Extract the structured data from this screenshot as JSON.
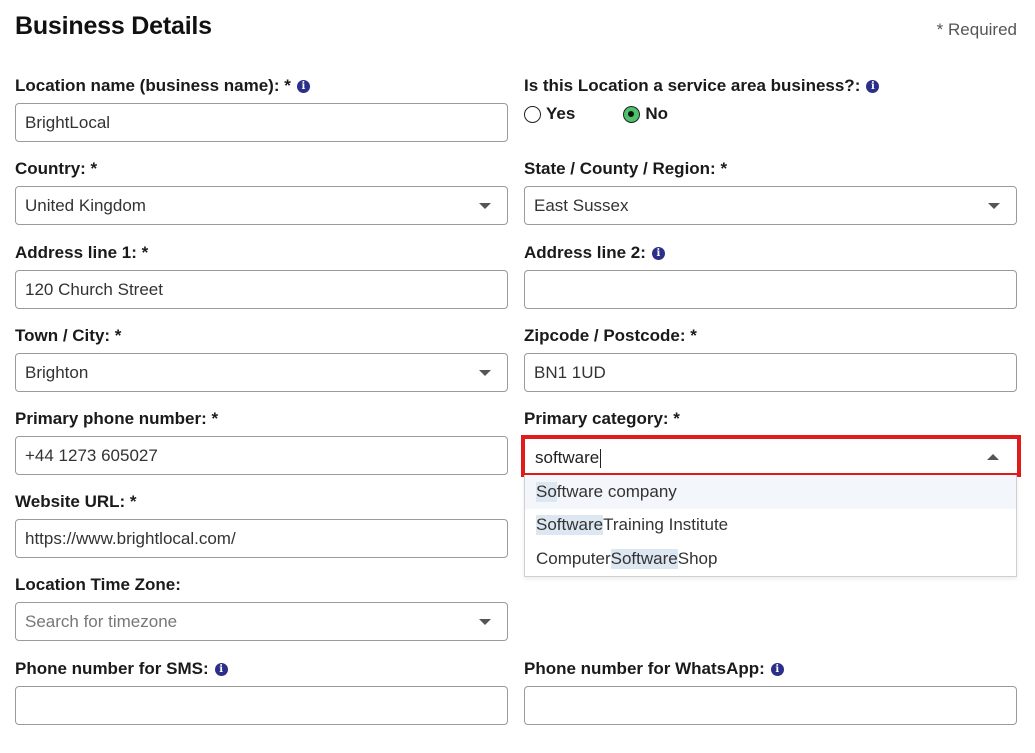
{
  "header": {
    "title": "Business Details",
    "required_note": "* Required"
  },
  "fields": {
    "location_name": {
      "label": "Location name (business name): *",
      "value": "BrightLocal"
    },
    "service_area": {
      "label": "Is this Location a service area business?:",
      "options": [
        "Yes",
        "No"
      ],
      "selected": "No"
    },
    "country": {
      "label": "Country: *",
      "value": "United Kingdom"
    },
    "state": {
      "label": "State / County / Region: *",
      "value": "East Sussex"
    },
    "address1": {
      "label": "Address line 1: *",
      "value": "120 Church Street"
    },
    "address2": {
      "label": "Address line 2:",
      "value": ""
    },
    "town": {
      "label": "Town / City: *",
      "value": "Brighton"
    },
    "zipcode": {
      "label": "Zipcode / Postcode: *",
      "value": "BN1 1UD"
    },
    "phone": {
      "label": "Primary phone number: *",
      "value": "+44 1273 605027"
    },
    "category": {
      "label": "Primary category: *",
      "value": "software",
      "suggestions": [
        {
          "before": "",
          "match": "So",
          "after": "ftware company"
        },
        {
          "before": "",
          "match": "Software",
          "after": " Training Institute"
        },
        {
          "before": "Computer ",
          "match": "Software",
          "after": " Shop"
        }
      ]
    },
    "website": {
      "label": "Website URL: *",
      "value": "https://www.brightlocal.com/"
    },
    "timezone": {
      "label": "Location Time Zone:",
      "placeholder": "Search for timezone"
    },
    "sms": {
      "label": "Phone number for SMS:",
      "value": ""
    },
    "whatsapp": {
      "label": "Phone number for WhatsApp:",
      "value": ""
    }
  },
  "icons": {
    "info": "info-icon",
    "dropdown": "chevron-down-icon"
  },
  "colors": {
    "info_icon": "#2c2f8a",
    "radio_checked": "#4cc36b",
    "highlight_border": "#e01b1b"
  }
}
